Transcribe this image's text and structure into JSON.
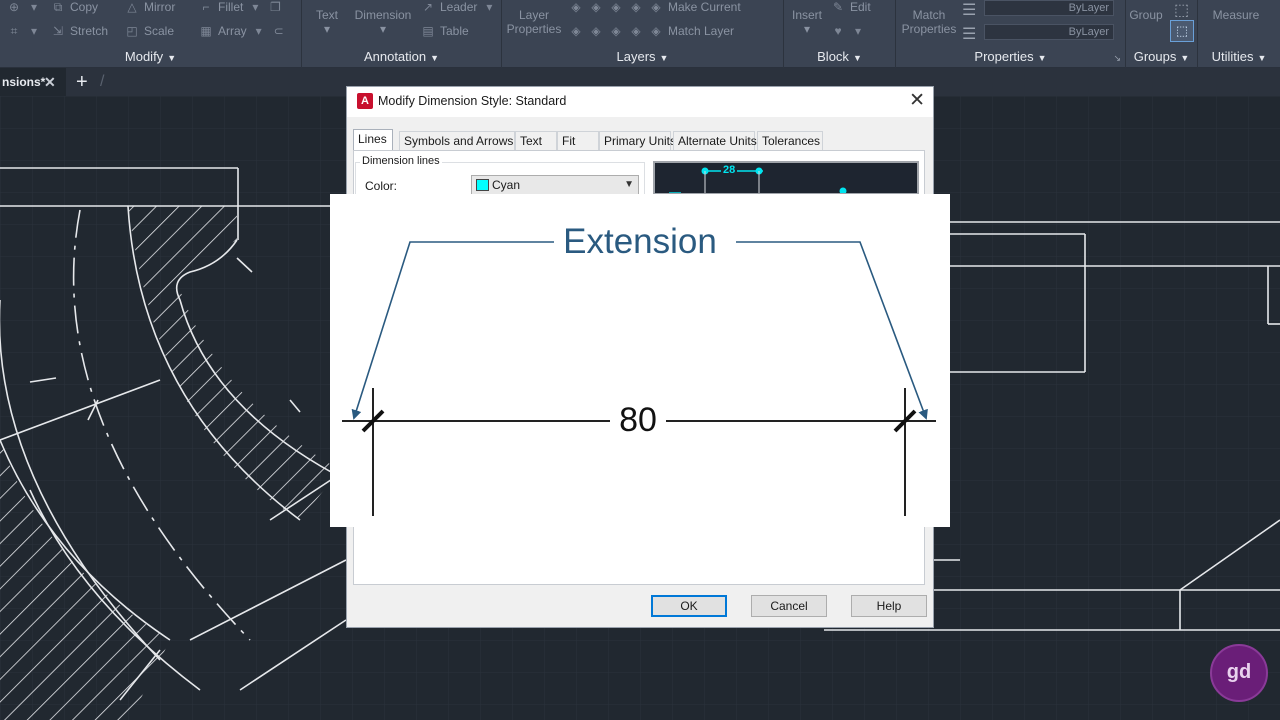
{
  "ribbon": {
    "panels": {
      "modify": {
        "title": "Modify",
        "tools": [
          "Copy",
          "Mirror",
          "Fillet",
          "Stretch",
          "Scale",
          "Array"
        ]
      },
      "annotation": {
        "title": "Annotation",
        "tools": [
          "Text",
          "Dimension",
          "Leader",
          "Table"
        ]
      },
      "layers": {
        "title": "Layers",
        "tools": [
          "Layer Properties",
          "Make Current",
          "Match Layer"
        ]
      },
      "block": {
        "title": "Block",
        "tools": [
          "Insert",
          "Edit"
        ]
      },
      "properties": {
        "title": "Properties",
        "tools": [
          "Match Properties",
          "ByLayer",
          "ByLayer"
        ]
      },
      "groups": {
        "title": "Groups",
        "tools": [
          "Group"
        ]
      },
      "utilities": {
        "title": "Utilities",
        "tools": [
          "Measure"
        ]
      }
    }
  },
  "document_tab": {
    "label": "nsions*"
  },
  "dialog": {
    "title": "Modify Dimension Style: Standard",
    "tabs": [
      "Lines",
      "Symbols and Arrows",
      "Text",
      "Fit",
      "Primary Units",
      "Alternate Units",
      "Tolerances"
    ],
    "active_tab": "Lines",
    "dimension_lines_group": "Dimension lines",
    "color_label": "Color:",
    "color_value": "Cyan",
    "preview_dimension": "28",
    "buttons": {
      "ok": "OK",
      "cancel": "Cancel",
      "help": "Help"
    }
  },
  "overlay": {
    "heading": "Extension",
    "dimension_value": "80"
  },
  "watermark": {
    "text": "gd"
  },
  "colors": {
    "accent": "#0078d7",
    "cyan": "#00ffff",
    "heading": "#2a5a80",
    "drawing_bg": "#212830",
    "ribbon_bg": "#3b4453"
  }
}
